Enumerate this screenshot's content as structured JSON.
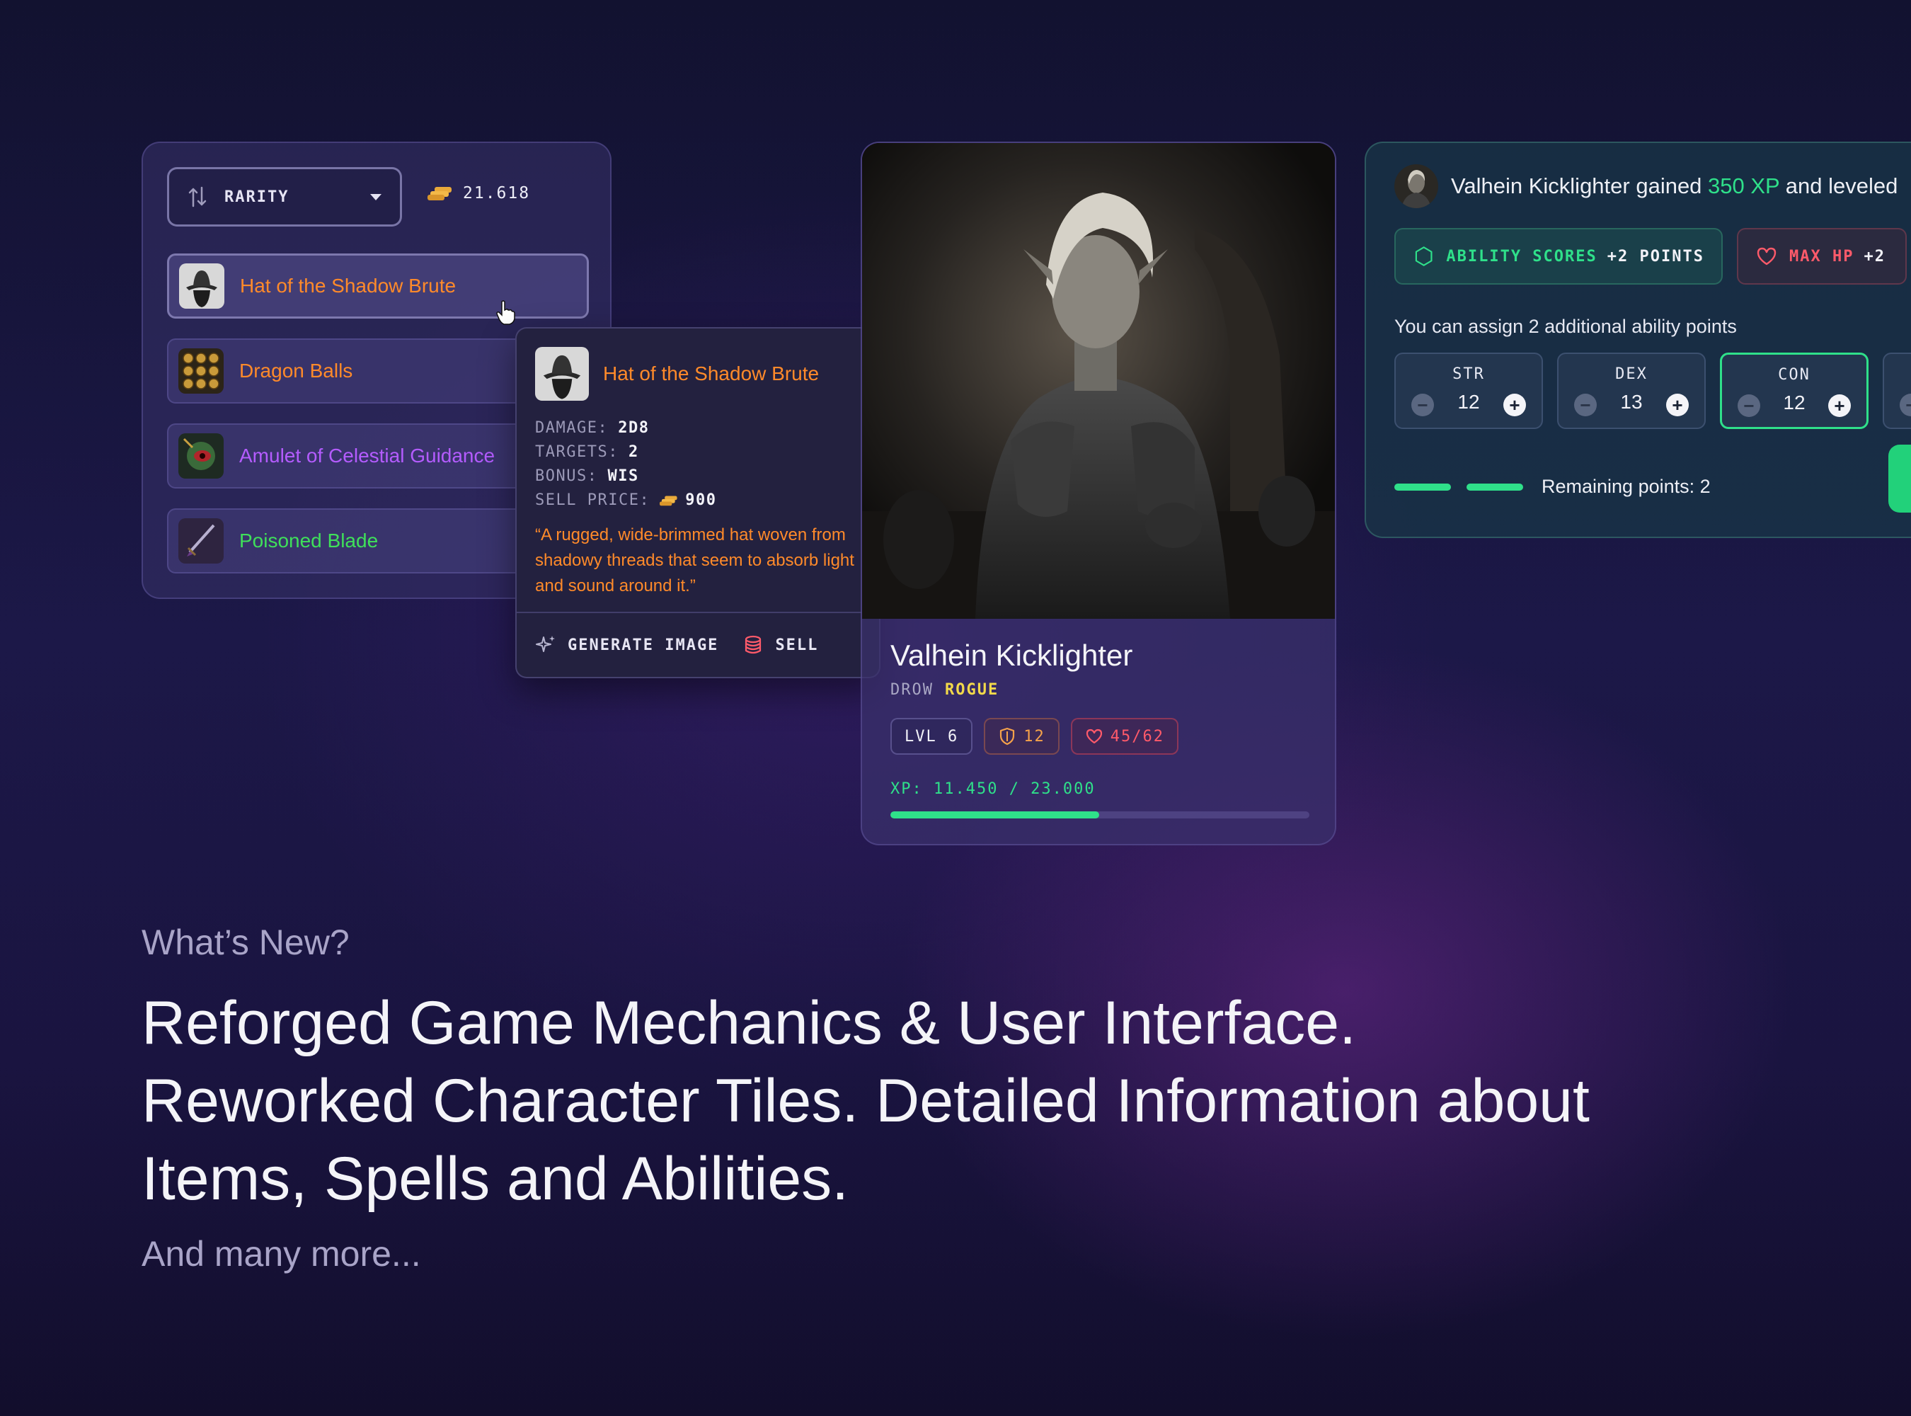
{
  "inventory": {
    "sort_label": "RARITY",
    "gold": "21.618",
    "items": [
      {
        "name": "Hat of the Shadow Brute",
        "color": "#ff8a2a"
      },
      {
        "name": "Dragon Balls",
        "color": "#ff8a2a"
      },
      {
        "name": "Amulet of Celestial Guidance",
        "color": "#b45cff"
      },
      {
        "name": "Poisoned Blade",
        "color": "#3fe05a"
      }
    ]
  },
  "tooltip": {
    "title": "Hat of the Shadow Brute",
    "stats": [
      {
        "key": "DAMAGE:",
        "value": "2D8"
      },
      {
        "key": "TARGETS:",
        "value": "2"
      },
      {
        "key": "BONUS:",
        "value": "WIS"
      },
      {
        "key": "SELL PRICE:",
        "value": "900",
        "icon": "gold-coins-icon"
      }
    ],
    "description": "“A rugged, wide-brimmed hat woven from shadowy threads that seem to absorb light and sound around it.”",
    "actions": {
      "generate": "GENERATE IMAGE",
      "sell": "SELL"
    }
  },
  "character": {
    "name": "Valhein Kicklighter",
    "race": "DROW",
    "class": "ROGUE",
    "level": "LVL 6",
    "armor": "12",
    "hp": "45/62",
    "xp_text": "XP: 11.450 / 23.000",
    "xp_current": 11450,
    "xp_max": 23000
  },
  "levelup": {
    "message_prefix": "Valhein Kicklighter gained ",
    "message_xp": "350 XP",
    "message_suffix": " and leveled",
    "ability_chip": {
      "label": "ABILITY SCORES",
      "value": "+2 POINTS"
    },
    "hp_chip": {
      "label": "MAX HP",
      "value": "+2"
    },
    "assign_text": "You can assign 2 additional ability points",
    "abilities": [
      {
        "name": "STR",
        "value": "12",
        "selected": false
      },
      {
        "name": "DEX",
        "value": "13",
        "selected": false
      },
      {
        "name": "CON",
        "value": "12",
        "selected": true
      }
    ],
    "remaining": "Remaining points: 2",
    "points_total": 2
  },
  "copy": {
    "eyebrow": "What’s New?",
    "headline_1": "Reforged Game Mechanics & User Interface.",
    "headline_2": "Reworked Character Tiles. Detailed Information about",
    "headline_3": "Items, Spells and Abilities.",
    "more": "And many more..."
  },
  "colors": {
    "accent_green": "#2fe08a",
    "legendary_orange": "#ff8a2a",
    "epic_purple": "#b45cff",
    "uncommon_green": "#3fe05a",
    "hp_red": "#ff5a6a",
    "class_yellow": "#f2d94a"
  }
}
